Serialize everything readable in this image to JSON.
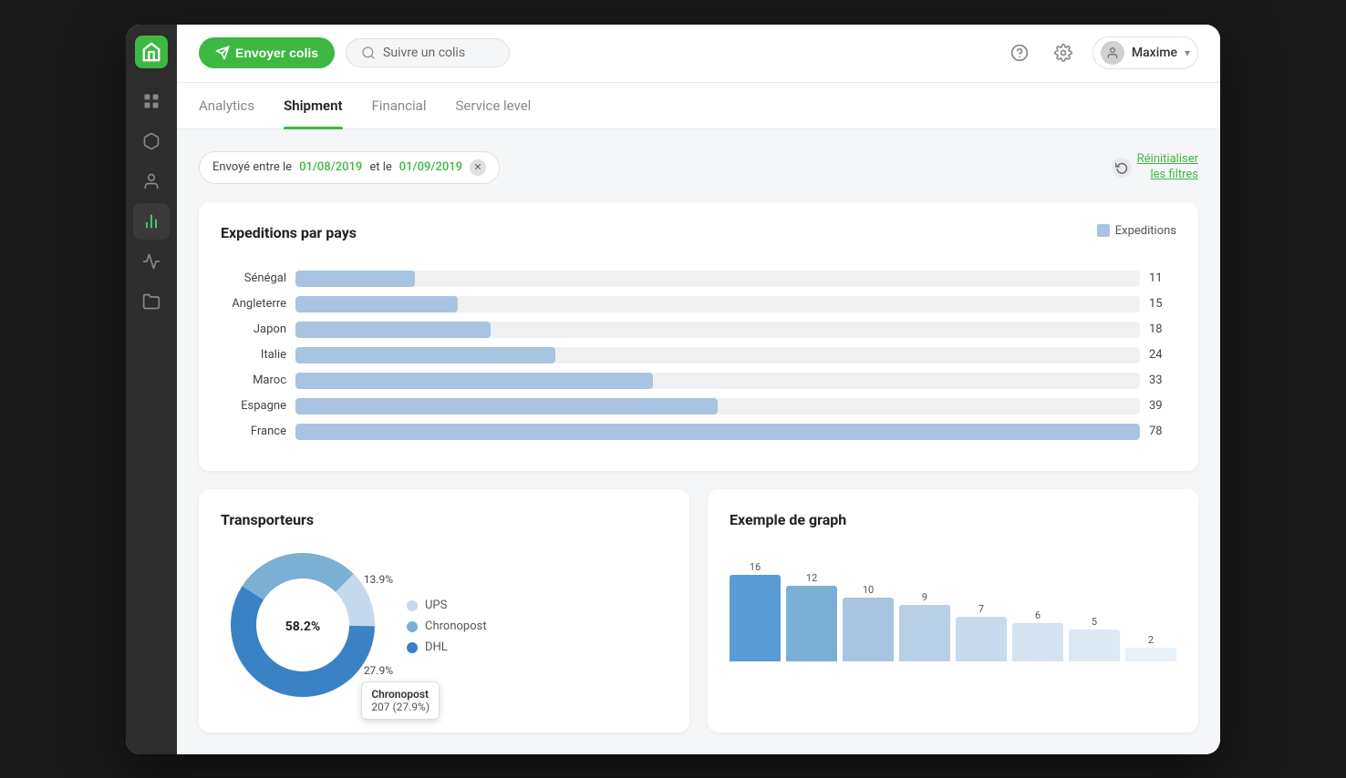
{
  "header": {
    "send_label": "Envoyer colis",
    "search_placeholder": "Suivre un colis",
    "user_name": "Maxime"
  },
  "tabs": [
    {
      "id": "analytics",
      "label": "Analytics",
      "active": false
    },
    {
      "id": "shipment",
      "label": "Shipment",
      "active": true
    },
    {
      "id": "financial",
      "label": "Financial",
      "active": false
    },
    {
      "id": "service-level",
      "label": "Service level",
      "active": false
    }
  ],
  "filter": {
    "prefix": "Envoyé entre le",
    "date_from": "01/08/2019",
    "separator": "et le",
    "date_to": "01/09/2019",
    "reset_label": "Réinitialiser\nles filtres"
  },
  "bar_chart": {
    "title": "Expeditions par pays",
    "legend_label": "Expeditions",
    "max_value": 78,
    "rows": [
      {
        "label": "Sénégal",
        "value": 11
      },
      {
        "label": "Angleterre",
        "value": 15
      },
      {
        "label": "Japon",
        "value": 18
      },
      {
        "label": "Italie",
        "value": 24
      },
      {
        "label": "Maroc",
        "value": 33
      },
      {
        "label": "Espagne",
        "value": 39
      },
      {
        "label": "France",
        "value": 78
      }
    ]
  },
  "donut_chart": {
    "title": "Transporteurs",
    "segments": [
      {
        "label": "UPS",
        "value": 13.9,
        "color": "#c5d8ec"
      },
      {
        "label": "Chronopost",
        "value": 27.9,
        "color": "#7bafd4"
      },
      {
        "label": "DHL",
        "value": 58.2,
        "color": "#3b82c4"
      }
    ],
    "tooltip": {
      "label": "Chronopost",
      "value": "207 (27.9%)"
    }
  },
  "vchart": {
    "title": "Exemple de graph",
    "bars": [
      {
        "label": "",
        "value": 16
      },
      {
        "label": "",
        "value": 12
      },
      {
        "label": "",
        "value": 10
      },
      {
        "label": "",
        "value": 9
      },
      {
        "label": "",
        "value": 7
      },
      {
        "label": "",
        "value": 6
      },
      {
        "label": "",
        "value": 5
      },
      {
        "label": "",
        "value": 2
      }
    ]
  }
}
